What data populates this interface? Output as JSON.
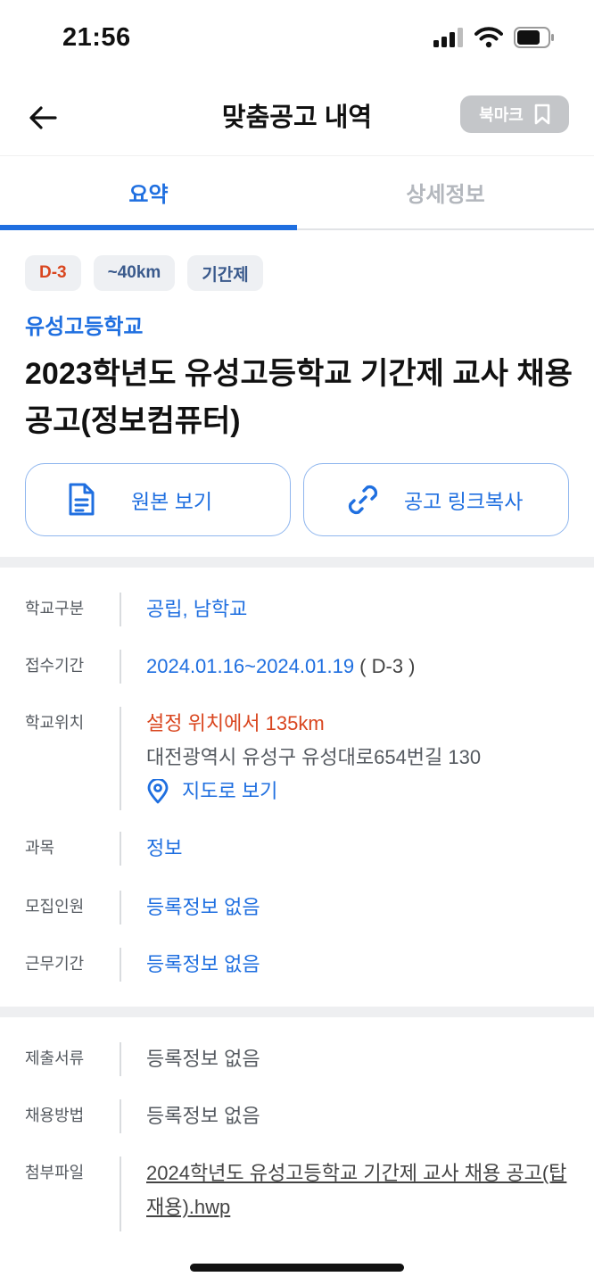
{
  "status_bar": {
    "time": "21:56"
  },
  "header": {
    "title": "맞춤공고 내역",
    "bookmark_label": "북마크"
  },
  "tabs": [
    {
      "label": "요약",
      "active": true
    },
    {
      "label": "상세정보",
      "active": false
    }
  ],
  "summary": {
    "badges": [
      "D-3",
      "~40km",
      "기간제"
    ],
    "school_name": "유성고등학교",
    "title": "2023학년도 유성고등학교 기간제 교사 채용 공고(정보컴퓨터)",
    "view_original_label": "원본 보기",
    "copy_link_label": "공고 링크복사"
  },
  "info_primary": {
    "school_type": {
      "label": "학교구분",
      "value": "공립, 남학교"
    },
    "period": {
      "label": "접수기간",
      "value": "2024.01.16~2024.01.19",
      "dday": " ( D-3 )"
    },
    "location": {
      "label": "학교위치",
      "distance": "설정 위치에서 135km",
      "address": "대전광역시 유성구 유성대로654번길 130",
      "map_label": "지도로 보기"
    },
    "subject": {
      "label": "과목",
      "value": "정보"
    },
    "recruits": {
      "label": "모집인원",
      "value": "등록정보 없음"
    },
    "work_period": {
      "label": "근무기간",
      "value": "등록정보 없음"
    }
  },
  "info_secondary": {
    "documents": {
      "label": "제출서류",
      "value": "등록정보 없음"
    },
    "method": {
      "label": "채용방법",
      "value": "등록정보 없음"
    },
    "attachment": {
      "label": "첨부파일",
      "value": "2024학년도 유성고등학교 기간제 교사 채용 공고(탑재용).hwp"
    }
  },
  "colors": {
    "accent": "#1f6fe0",
    "alert": "#d9461f",
    "bookmark_bg": "#c4c6c9"
  },
  "icons": [
    "signal-icon",
    "wifi-icon",
    "battery-icon",
    "back-arrow-icon",
    "bookmark-icon",
    "document-icon",
    "link-icon",
    "location-pin-icon"
  ]
}
